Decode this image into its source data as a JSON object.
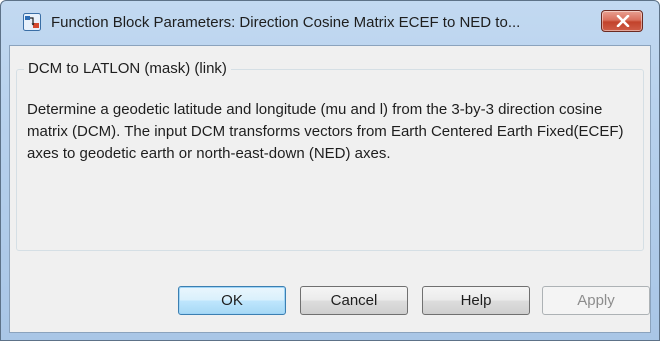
{
  "window": {
    "title": "Function Block Parameters: Direction Cosine Matrix ECEF to NED to...",
    "icon": "simulink-block-icon",
    "close_icon": "close-icon"
  },
  "group": {
    "title": "DCM to LATLON (mask) (link)",
    "description": "Determine a geodetic latitude and longitude (mu and l) from the 3-by-3 direction cosine matrix (DCM). The input DCM transforms vectors from Earth Centered Earth Fixed(ECEF) axes to geodetic earth or north-east-down (NED) axes."
  },
  "buttons": {
    "ok": "OK",
    "cancel": "Cancel",
    "help": "Help",
    "apply": "Apply"
  },
  "colors": {
    "titlebar": "#b6d0ec",
    "close_button": "#c2432b",
    "client_bg": "#f0f0f0",
    "default_button_border": "#3c7fb1",
    "disabled_text": "#8d8d8d"
  }
}
